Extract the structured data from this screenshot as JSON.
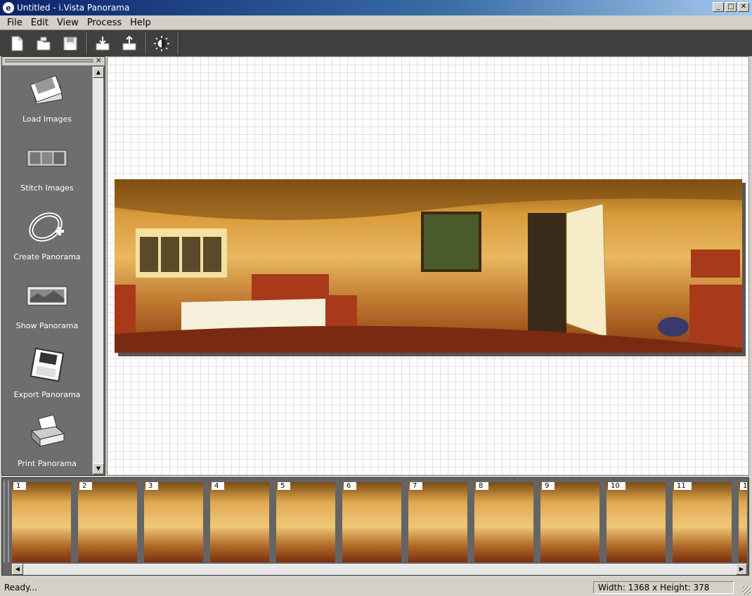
{
  "window": {
    "title": "Untitled - i.Vista Panorama",
    "min": "_",
    "max": "□",
    "close": "✕"
  },
  "menu": [
    "File",
    "Edit",
    "View",
    "Process",
    "Help"
  ],
  "toolbar": {
    "buttons": [
      "new-icon",
      "open-icon",
      "save-icon",
      "import-icon",
      "export-icon",
      "brightness-icon"
    ]
  },
  "sidebar": {
    "close": "×",
    "items": [
      {
        "label": "Load Images",
        "icon": "load-images-icon"
      },
      {
        "label": "Stitch Images",
        "icon": "stitch-images-icon"
      },
      {
        "label": "Create Panorama",
        "icon": "create-panorama-icon"
      },
      {
        "label": "Show Panorama",
        "icon": "show-panorama-icon"
      },
      {
        "label": "Export Panorama",
        "icon": "export-panorama-icon"
      },
      {
        "label": "Print Panorama",
        "icon": "print-panorama-icon"
      }
    ]
  },
  "filmstrip": {
    "thumbnails": [
      "1",
      "2",
      "3",
      "4",
      "5",
      "6",
      "7",
      "8",
      "9",
      "10",
      "11",
      "1"
    ]
  },
  "status": {
    "text": "Ready...",
    "size": "Width:  1368 x Height:   378"
  }
}
